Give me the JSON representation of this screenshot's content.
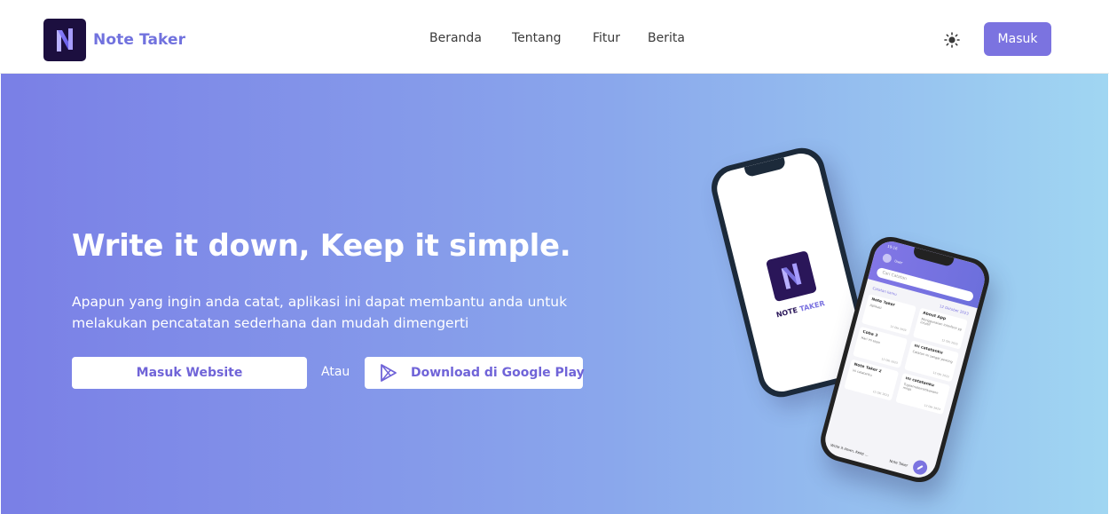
{
  "navbar": {
    "brand_name": "Note Taker",
    "links": [
      "Beranda",
      "Tentang",
      "Fitur",
      "Berita"
    ],
    "theme_icon": "sun-icon",
    "login_label": "Masuk"
  },
  "hero": {
    "title": "Write it down, Keep it simple.",
    "description": "Apapun yang ingin anda catat, aplikasi ini dapat membantu anda untuk melakukan pencatatan sederhana dan mudah dimengerti",
    "primary_button": "Masuk Website",
    "separator": "Atau",
    "play_button": "Download di Google Play",
    "play_icon": "google-play-icon"
  },
  "mockup": {
    "splash_name_primary": "NOTE ",
    "splash_name_accent": "TAKER",
    "status_time": "19:16",
    "user_name": "User",
    "search_placeholder": "Cari Catatan",
    "list_title": "Catatan kamu",
    "list_date": "12 Oktober 2023",
    "notes": [
      {
        "title": "Note Taker",
        "body": "Aplikasi",
        "date": "12 Okt 2023"
      },
      {
        "title": "About App",
        "body": "Menggunakan interface yg intuitif",
        "date": "12 Okt 2023"
      },
      {
        "title": "Coba 3",
        "body": "Hari ini saya",
        "date": "12 Okt 2023"
      },
      {
        "title": "ini catatanku",
        "body": "Catatan ini sangat penting",
        "date": "12 Okt 2023"
      },
      {
        "title": "Note Taker 2",
        "body": "ini catatanku",
        "date": "12 Okt 2023"
      },
      {
        "title": "ini catatanku",
        "body": "Tugasmatematikananir mngs",
        "date": "12 Okt 2023"
      }
    ],
    "bottom_left": "Write it down, Keep ...",
    "bottom_right": "Note Taker"
  },
  "colors": {
    "accent": "#7b73e0",
    "brand_text": "#7172de",
    "logo_bg": "#1c0f3f",
    "hero_start": "#7a7fe6",
    "hero_end": "#a0d6f2"
  }
}
